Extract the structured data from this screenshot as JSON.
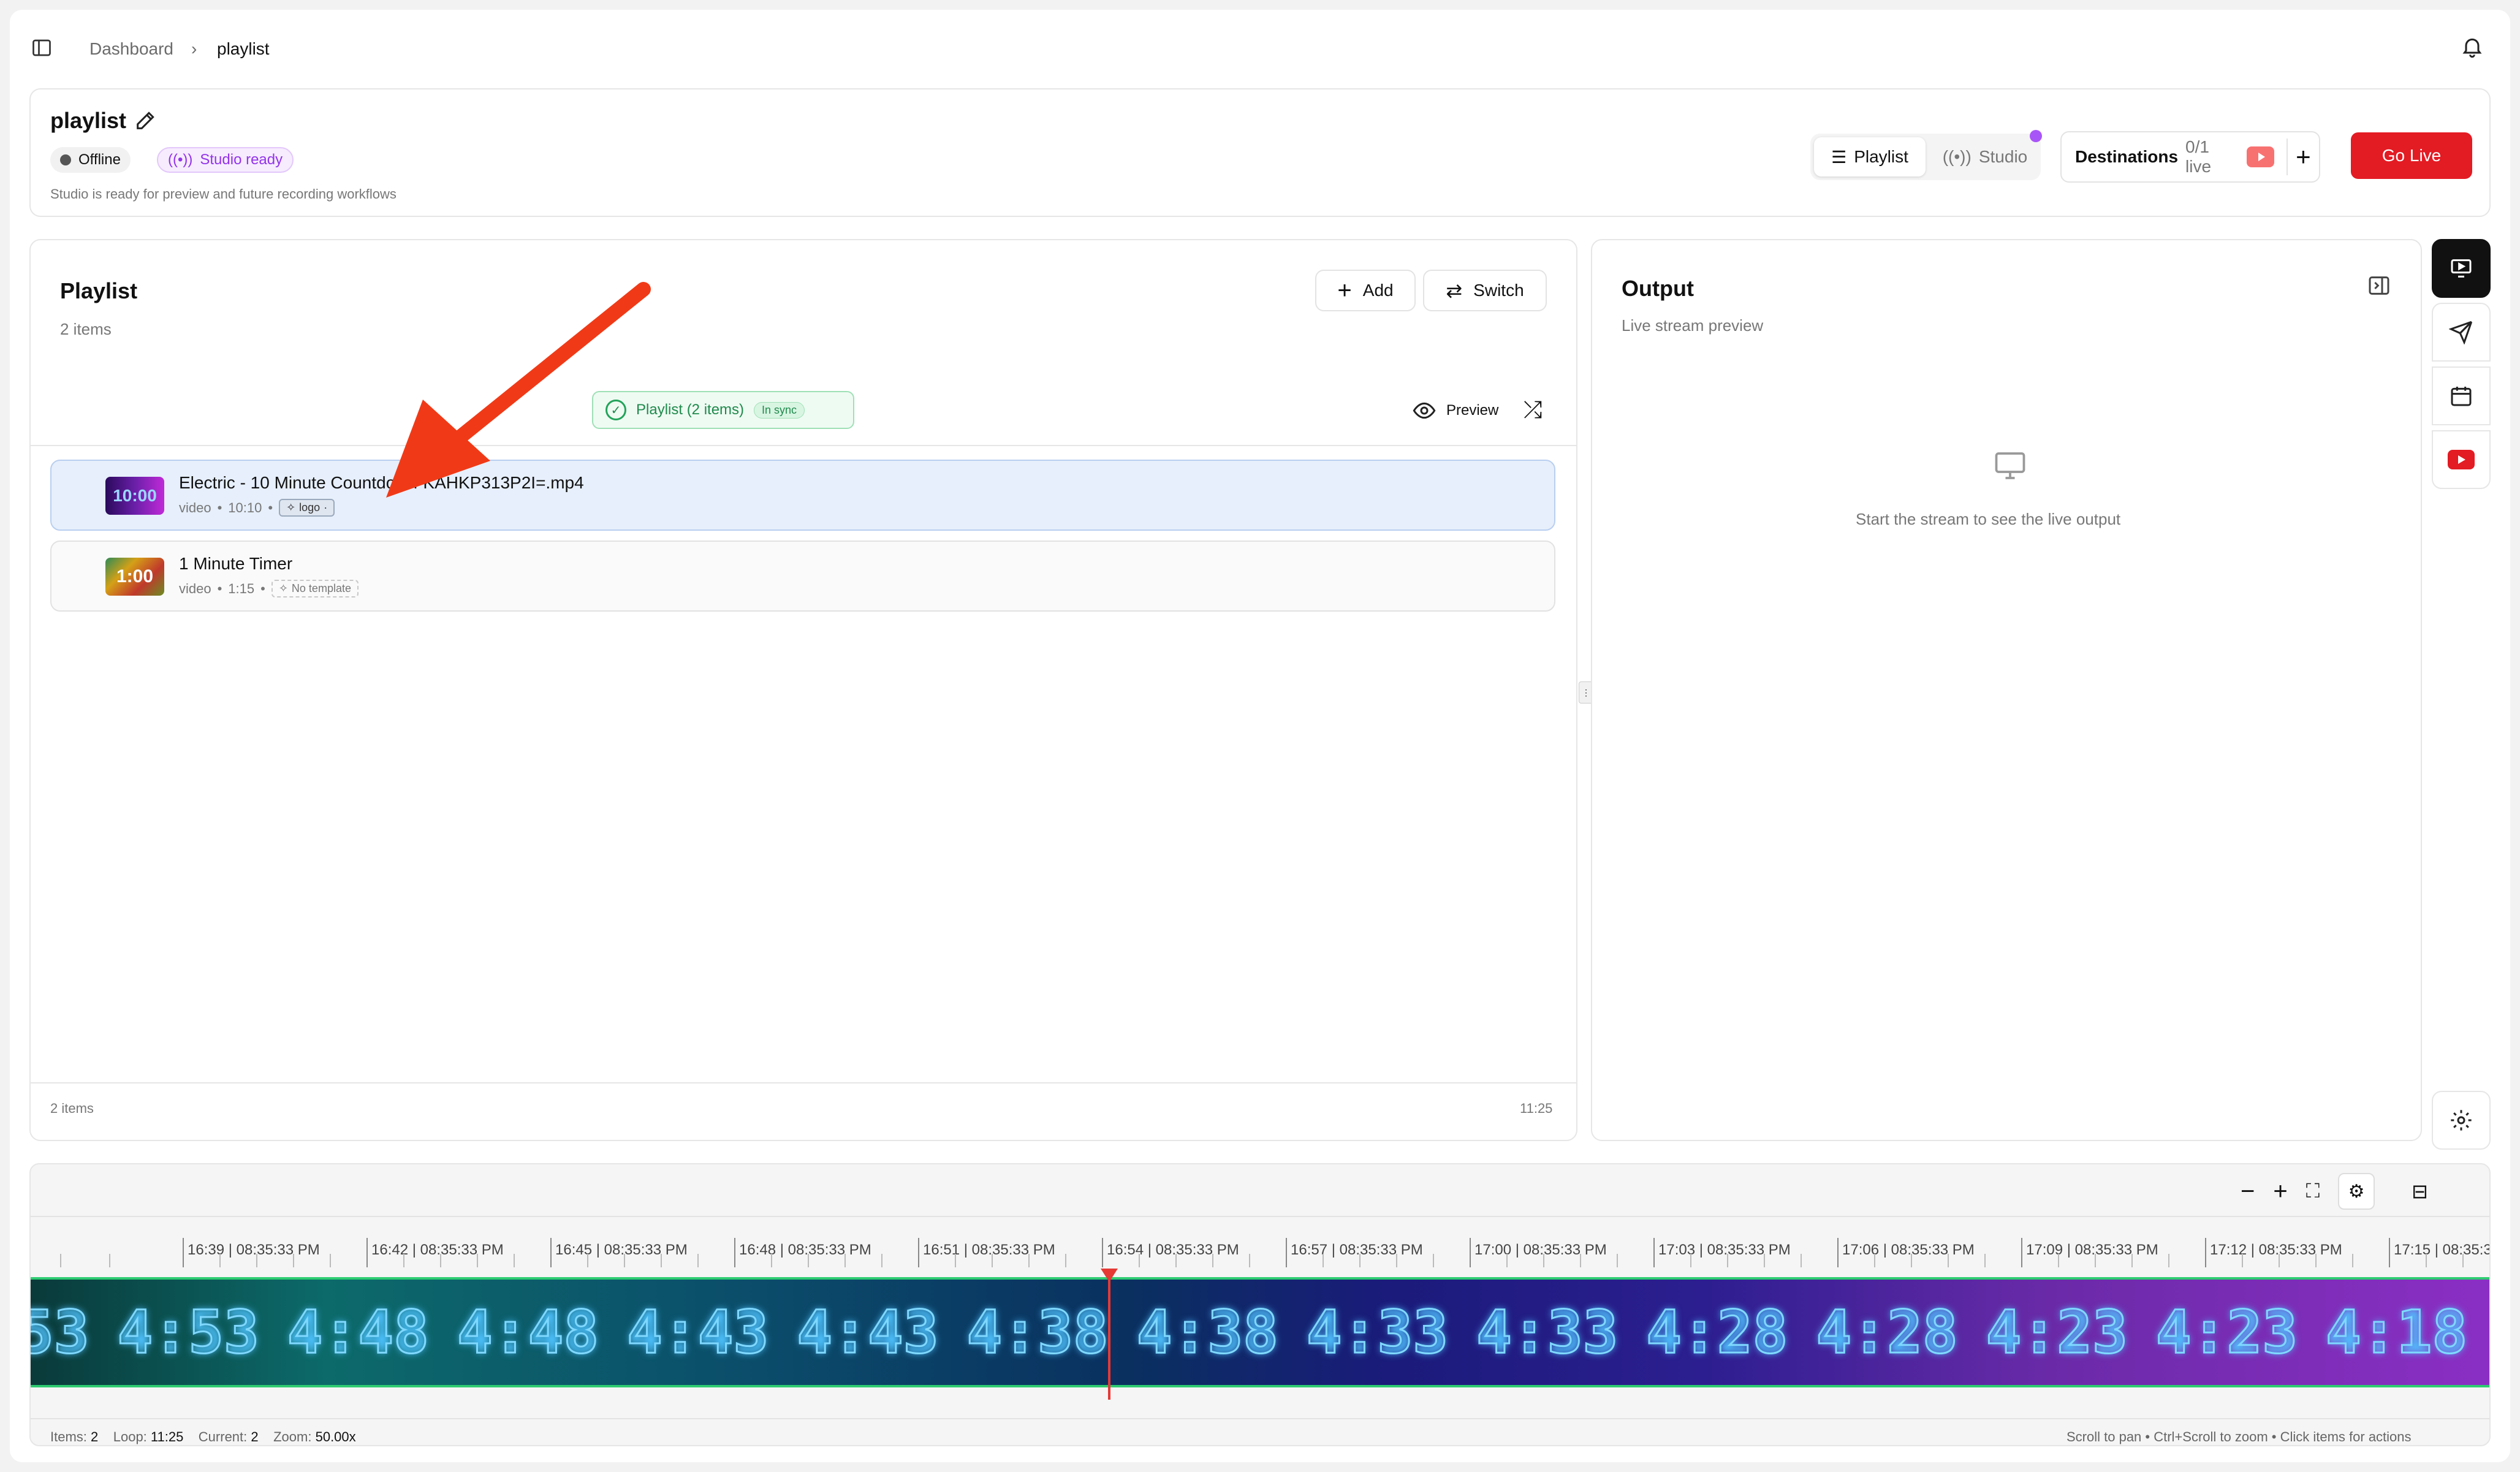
{
  "breadcrumb": {
    "root": "Dashboard",
    "current": "playlist"
  },
  "header": {
    "title": "playlist",
    "status_offline": "Offline",
    "status_studio": "Studio ready",
    "description": "Studio is ready for preview and future recording workflows",
    "mode_playlist": "Playlist",
    "mode_studio": "Studio",
    "destinations_label": "Destinations",
    "destinations_count": "0/1 live",
    "go_live": "Go Live"
  },
  "playlist_panel": {
    "title": "Playlist",
    "count": "2 items",
    "add_label": "Add",
    "switch_label": "Switch",
    "sync_label": "Playlist (2 items)",
    "sync_badge": "In sync",
    "preview_label": "Preview",
    "items": [
      {
        "title": "Electric - 10 Minute Countdown-KAHKP313P2I=.mp4",
        "type": "video",
        "duration": "10:10",
        "tag": "logo",
        "thumb_text": "10:00"
      },
      {
        "title": "1 Minute Timer",
        "type": "video",
        "duration": "1:15",
        "tag": "No template",
        "thumb_text": "1:00"
      }
    ],
    "footer_count": "2 items",
    "footer_total": "11:25"
  },
  "output_panel": {
    "title": "Output",
    "subtitle": "Live stream preview",
    "empty_text": "Start the stream to see the live output"
  },
  "timeline": {
    "ticks": [
      "16:39 | 08:35:33 PM",
      "16:42 | 08:35:33 PM",
      "16:45 | 08:35:33 PM",
      "16:48 | 08:35:33 PM",
      "16:51 | 08:35:33 PM",
      "16:54 | 08:35:33 PM",
      "16:57 | 08:35:33 PM",
      "17:00 | 08:35:33 PM",
      "17:03 | 08:35:33 PM",
      "17:06 | 08:35:33 PM",
      "17:09 | 08:35:33 PM",
      "17:12 | 08:35:33 PM",
      "17:15 | 08:35:3"
    ],
    "frames": [
      "53",
      "4:53",
      "4:48",
      "4:48",
      "4:43",
      "4:43",
      "4:38",
      "4:38",
      "4:33",
      "4:33",
      "4:28",
      "4:28",
      "4:23",
      "4:23",
      "4:18",
      "4:18",
      "4:1"
    ],
    "status": {
      "items_label": "Items:",
      "items_value": "2",
      "loop_label": "Loop:",
      "loop_value": "11:25",
      "current_label": "Current:",
      "current_value": "2",
      "zoom_label": "Zoom:",
      "zoom_value": "50.00x"
    },
    "hint": "Scroll to pan • Ctrl+Scroll to zoom • Click items for actions"
  },
  "colors": {
    "accent_red": "#e31b23",
    "studio_purple": "#a855f7",
    "sync_green": "#22a35a",
    "playhead": "#e53935"
  }
}
